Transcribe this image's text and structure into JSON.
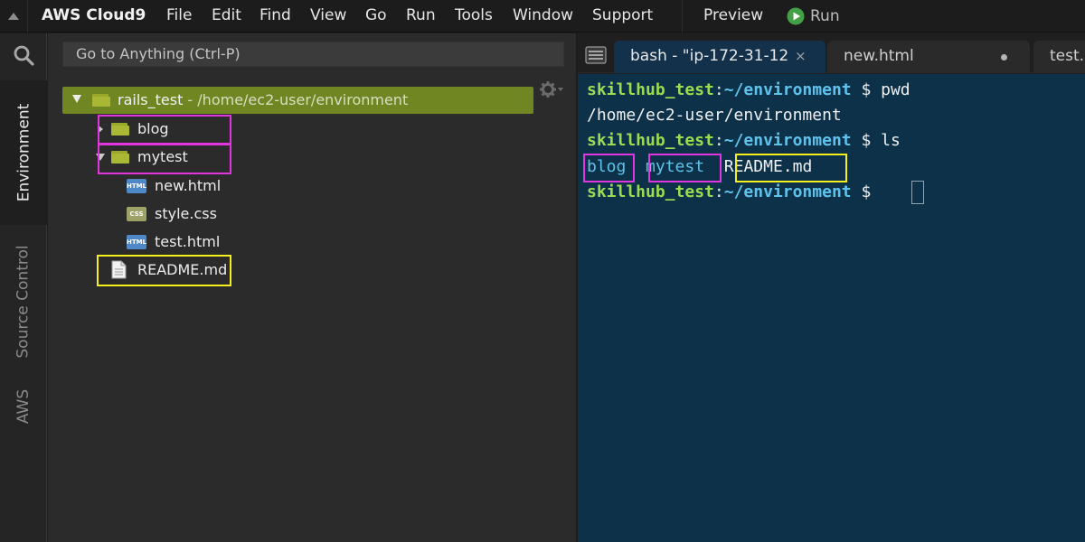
{
  "menubar": {
    "app_title": "AWS Cloud9",
    "items": [
      "File",
      "Edit",
      "Find",
      "View",
      "Go",
      "Run",
      "Tools",
      "Window",
      "Support"
    ],
    "preview_label": "Preview",
    "run_label": "Run",
    "collapse_icon": "triangle-up-icon",
    "run_icon": "play-icon"
  },
  "activitybar": {
    "search_icon": "search-icon",
    "tabs": [
      "Environment",
      "Source Control",
      "AWS"
    ],
    "active_tab": "Environment"
  },
  "sidebar": {
    "goto_placeholder": "Go to Anything (Ctrl-P)",
    "gear_icon": "gear-icon",
    "root": {
      "name": "rails_test",
      "path": " - /home/ec2-user/environment",
      "expanded": true
    },
    "items": [
      {
        "label": "blog",
        "type": "folder",
        "expanded": false
      },
      {
        "label": "mytest",
        "type": "folder",
        "expanded": true
      },
      {
        "label": "new.html",
        "type": "html",
        "badge": "HTML"
      },
      {
        "label": "style.css",
        "type": "css",
        "badge": "CSS"
      },
      {
        "label": "test.html",
        "type": "html",
        "badge": "HTML"
      },
      {
        "label": "README.md",
        "type": "markdown"
      }
    ]
  },
  "tabs": [
    {
      "label": "bash - \"ip-172-31-12",
      "active": true,
      "close": "×"
    },
    {
      "label": "new.html",
      "unsaved": true
    },
    {
      "label": "test.h"
    }
  ],
  "terminal": {
    "lines": [
      {
        "user": "skillhub_test",
        "colon": ":",
        "path": "~/environment",
        "cmd": " $ pwd"
      },
      {
        "out": "/home/ec2-user/environment"
      },
      {
        "user": "skillhub_test",
        "colon": ":",
        "path": "~/environment",
        "cmd": " $ ls"
      },
      {
        "entries": [
          "blog",
          "mytest",
          "README.md"
        ]
      },
      {
        "user": "skillhub_test",
        "colon": ":",
        "path": "~/environment",
        "cmd": " $ "
      }
    ]
  },
  "colors": {
    "highlight_folders": "#e135e0",
    "highlight_file": "#f4ef1d",
    "root_bg": "#6f8623",
    "terminal_bg": "#0d3149",
    "prompt_user": "#9adc52",
    "prompt_path": "#5ec3ec"
  }
}
